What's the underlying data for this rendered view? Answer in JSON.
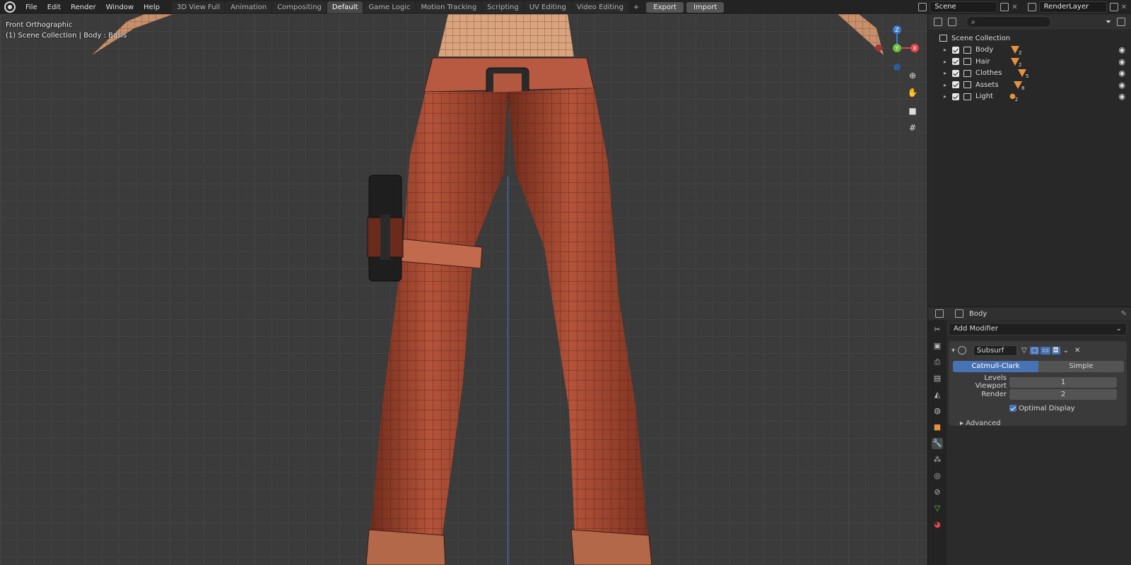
{
  "menu": [
    "File",
    "Edit",
    "Render",
    "Window",
    "Help"
  ],
  "workspaces": [
    {
      "label": "3D View Full",
      "active": false
    },
    {
      "label": "Animation",
      "active": false
    },
    {
      "label": "Compositing",
      "active": false
    },
    {
      "label": "Default",
      "active": true
    },
    {
      "label": "Game Logic",
      "active": false
    },
    {
      "label": "Motion Tracking",
      "active": false
    },
    {
      "label": "Scripting",
      "active": false
    },
    {
      "label": "UV Editing",
      "active": false
    },
    {
      "label": "Video Editing",
      "active": false
    }
  ],
  "addons": {
    "export": "Export",
    "import": "Import"
  },
  "scene": {
    "name": "Scene",
    "view_layer": "RenderLayer"
  },
  "viewport": {
    "view": "Front Orthographic",
    "context": "(1) Scene Collection | Body : Basis"
  },
  "gizmo": {
    "z": "Z",
    "y": "Y",
    "x": "X"
  },
  "outliner": {
    "root": "Scene Collection",
    "collections": [
      {
        "name": "Body",
        "count": "2"
      },
      {
        "name": "Hair",
        "count": "2"
      },
      {
        "name": "Clothes",
        "count": "5"
      },
      {
        "name": "Assets",
        "count": "8"
      },
      {
        "name": "Light",
        "count": "2"
      }
    ]
  },
  "properties": {
    "object": "Body",
    "add_modifier": "Add Modifier",
    "modifier_name": "Subsurf",
    "mode_on": "Catmull-Clark",
    "mode_off": "Simple",
    "levels_label": "Levels Viewport",
    "levels_value": "1",
    "render_label": "Render",
    "render_value": "2",
    "optimal": "Optimal Display",
    "advanced": "Advanced"
  },
  "colors": {
    "accent": "#4772b3",
    "skin": "#c98a66",
    "pants": "#9a3f28"
  }
}
